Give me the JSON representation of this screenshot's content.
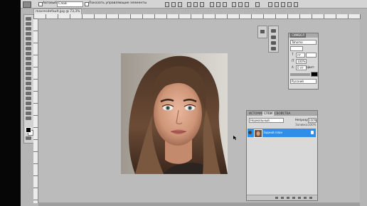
{
  "options_bar": {
    "autoselect_label": "Автовыбор:",
    "autoselect_value": "Слой",
    "show_transform_label": "Показать управляющие элементы"
  },
  "document": {
    "tab_title": "maxresdefault.jpg @ 73,3% (RGB/8*)"
  },
  "character_panel": {
    "tab_label": "СИМВОЛ",
    "font_family": "Tahoma",
    "font_size": "пт",
    "leading_value": "100%",
    "tracking_value": "0 пт",
    "color_label": "Цвет:",
    "language": "Русский"
  },
  "layers_panel": {
    "tabs": [
      "ИСТОРИЯ",
      "СЛОИ",
      "СВОЙСТВА"
    ],
    "active_tab": "СЛОИ",
    "blend_mode": "Нормальный",
    "opacity_label": "Непрозр.:",
    "opacity_value": "100%",
    "fill_label": "Заливка:",
    "fill_value": "100%",
    "layer_name": "Задний план"
  },
  "colors": {
    "selection_blue": "#2f8fe6",
    "workspace_gray": "#bbbbbb"
  }
}
